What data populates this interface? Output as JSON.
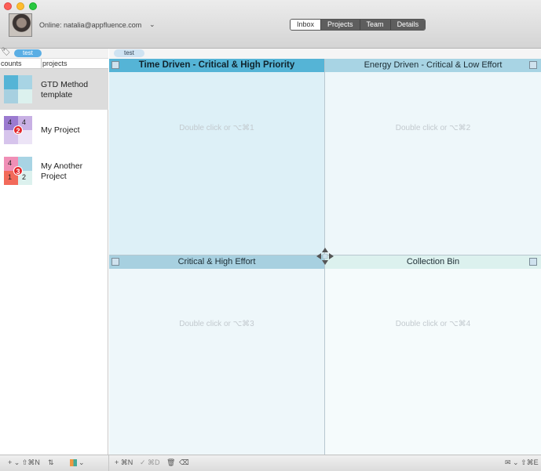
{
  "window": {
    "status_text": "Online: natalia@appfluence.com",
    "status_caret": "⌄"
  },
  "view_tabs": [
    {
      "label": "Inbox",
      "active": true
    },
    {
      "label": "Projects",
      "active": false
    },
    {
      "label": "Team",
      "active": false
    },
    {
      "label": "Details",
      "active": false
    }
  ],
  "sidebar": {
    "tag_label": "test",
    "columns": {
      "counts": "counts",
      "projects": "projects"
    },
    "projects": [
      {
        "name_line1": "GTD Method",
        "name_line2": "template",
        "cells": [
          "",
          "",
          "",
          ""
        ],
        "badge": ""
      },
      {
        "name_line1": "My Project",
        "name_line2": "",
        "cells": [
          "4",
          "4",
          "",
          ""
        ],
        "badge": "2"
      },
      {
        "name_line1": "My Another",
        "name_line2": "Project",
        "cells": [
          "4",
          "",
          "1",
          "2"
        ],
        "badge": "3"
      }
    ]
  },
  "main": {
    "tag_label": "test",
    "quadrants": [
      {
        "title": "Time Driven - Critical & High Priority",
        "hint": "Double click or ⌥⌘1"
      },
      {
        "title": "Energy Driven - Critical & Low Effort",
        "hint": "Double click or ⌥⌘2"
      },
      {
        "title": "Critical & High Effort",
        "hint": "Double click or ⌥⌘3"
      },
      {
        "title": "Collection Bin",
        "hint": "Double click or ⌥⌘4"
      }
    ]
  },
  "bottombar": {
    "add_project": "+ ⌄ ⇧⌘N",
    "sort": "⇅",
    "color_menu": "⌄",
    "add_item": "+ ⌘N",
    "done_item": "✓ ⌘D",
    "delete_item": "🗑",
    "clear": "⌫",
    "email": "✉ ⌄ ⇧⌘E"
  },
  "colors": {
    "q1_header": "#55b4d6",
    "q1_body": "#ddf0f7",
    "q2_header": "#a8d4e4",
    "q3_header": "#a7d0e0",
    "q4_header": "#dcf1ee",
    "badge": "#e3282b",
    "tag": "#5aaee4"
  }
}
